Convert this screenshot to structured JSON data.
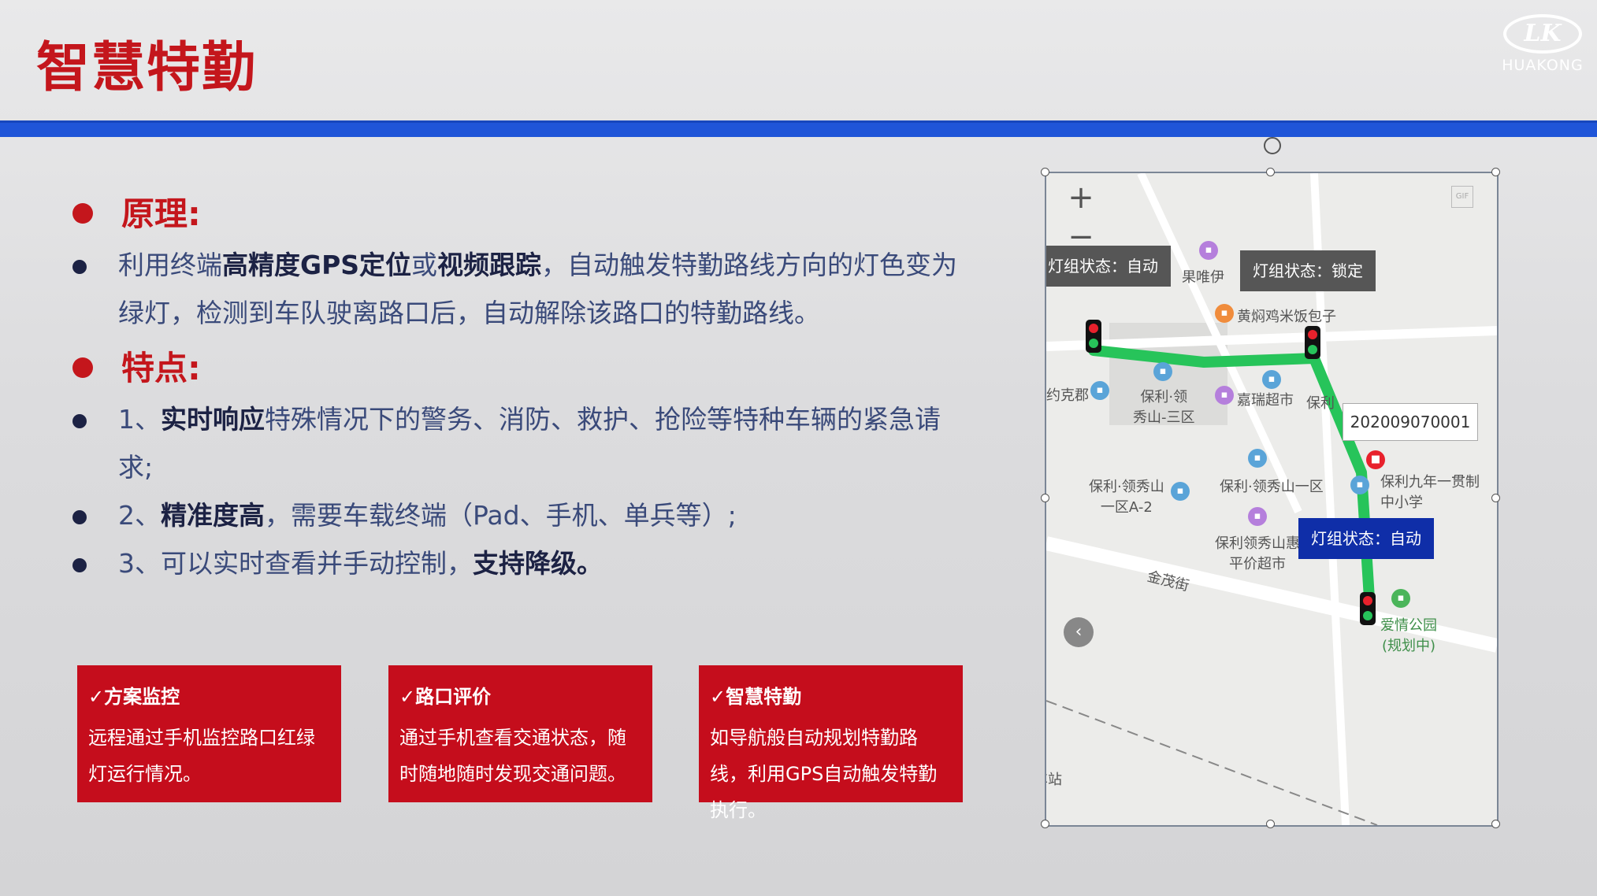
{
  "slide": {
    "title": "智慧特勤",
    "logo_text": "HUAKONG",
    "logo_mark": "LK"
  },
  "principle": {
    "heading": "原理:",
    "text_a": "利用终端",
    "bold_a": "高精度GPS定位",
    "text_b": "或",
    "bold_b": "视频跟踪",
    "text_c": "，自动触发特勤路线方向的灯色变为绿灯，检测到车队驶离路口后，自动解除该路口的特勤路线。"
  },
  "features": {
    "heading": "特点:",
    "items": [
      {
        "prefix": "1、",
        "bold": "实时响应",
        "text": "特殊情况下的警务、消防、救护、抢险等特种车辆的紧急请求;"
      },
      {
        "prefix": "2、",
        "bold": "精准度高",
        "text": "，需要车载终端（Pad、手机、单兵等）;"
      },
      {
        "prefix": "3、",
        "text": "可以实时查看并手动控制，",
        "bold": "支持降级。"
      }
    ]
  },
  "cards": [
    {
      "title": "✓方案监控",
      "body": "远程通过手机监控路口红绿灯运行情况。"
    },
    {
      "title": "✓路口评价",
      "body": "通过手机查看交通状态，随时随地随时发现交通问题。"
    },
    {
      "title": "✓智慧特勤",
      "body": "如导航般自动规划特勤路线，利用GPS自动触发特勤执行。"
    }
  ],
  "map": {
    "zoom_in": "+",
    "zoom_out": "−",
    "gif_label": "GIF",
    "vehicle_id": "202009070001",
    "states": {
      "left": "灯组状态：自动",
      "top": "灯组状态：锁定",
      "bottom": "灯组状态：自动"
    },
    "places": {
      "guoweiyi": "果唯伊",
      "huangmen": "黄焖鸡米饭包子",
      "yuekejun": "约克郡",
      "baoli_ling_sanqu": "保利·领\n秀山-三区",
      "jiarui": "嘉瑞超市",
      "baoli_short": "保利",
      "baoli_yiqu": "保利·领秀山一区",
      "baoli_a2": "保利·领秀山\n一区A-2",
      "baoli_school": "保利九年一贯制\n中小学",
      "baoli_market": "保利领秀山惠\n平价超市",
      "jinmao": "金茂街",
      "park": "爱情公园\n(规划中)",
      "station": "车站"
    },
    "colors": {
      "route": "#27c45a",
      "state_gray": "#565656",
      "state_blue": "#0f2ea8"
    }
  },
  "colors": {
    "accent_red": "#c4161c",
    "bar_blue": "#1f55d8",
    "card_red": "#c50d1c"
  }
}
